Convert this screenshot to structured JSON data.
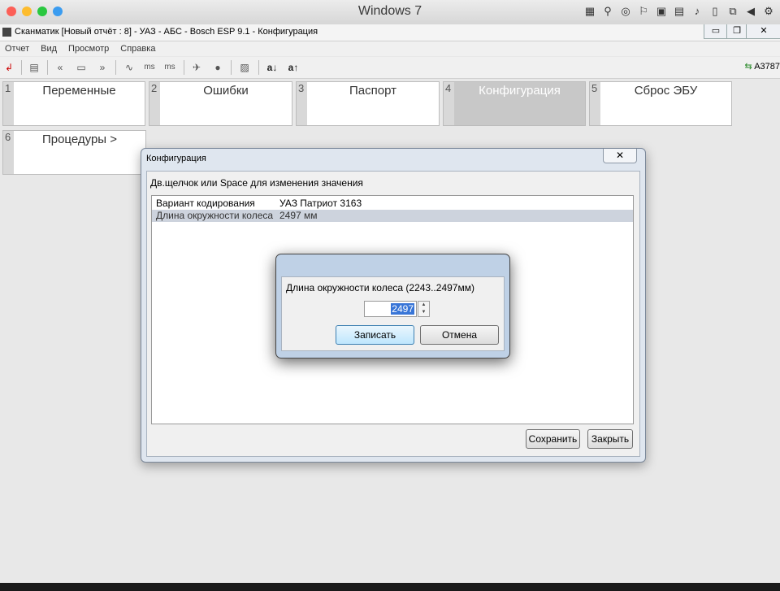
{
  "host": {
    "title": "Windows 7"
  },
  "app": {
    "title": "Сканматик [Новый отчёт : 8] - УАЗ - АБС - Bosch ESP 9.1 - Конфигурация",
    "menu": [
      "Отчет",
      "Вид",
      "Просмотр",
      "Справка"
    ],
    "toolbar_right": "A3787"
  },
  "tabs": [
    {
      "num": "1",
      "label": "Переменные"
    },
    {
      "num": "2",
      "label": "Ошибки"
    },
    {
      "num": "3",
      "label": "Паспорт"
    },
    {
      "num": "4",
      "label": "Конфигурация"
    },
    {
      "num": "5",
      "label": "Сброс ЭБУ"
    },
    {
      "num": "6",
      "label": "Процедуры >"
    }
  ],
  "config_dialog": {
    "title": "Конфигурация",
    "hint": "Дв.щелчок или Space для изменения значения",
    "rows": [
      {
        "name": "Вариант кодирования",
        "value": "УАЗ Патриот 3163"
      },
      {
        "name": "Длина окружности колеса",
        "value": "2497 мм"
      }
    ],
    "save_label": "Сохранить",
    "close_label": "Закрыть"
  },
  "input_dialog": {
    "label": "Длина окружности колеса (2243..2497мм)",
    "value": "2497",
    "ok_label": "Записать",
    "cancel_label": "Отмена"
  }
}
